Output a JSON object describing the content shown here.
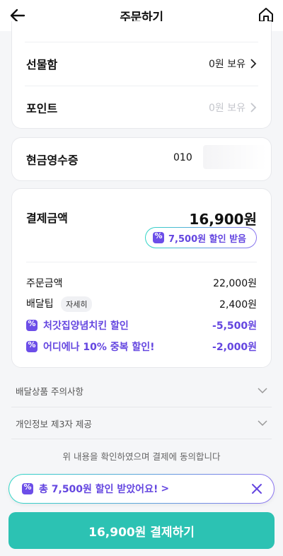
{
  "header": {
    "title": "주문하기",
    "back_icon": "arrow-left-icon",
    "home_icon": "home-icon"
  },
  "gift_box": {
    "label": "선물함",
    "value": "0원 보유"
  },
  "points": {
    "label": "포인트",
    "value": "0원 보유"
  },
  "cash_receipt": {
    "label": "현금영수증",
    "value": "010"
  },
  "payment": {
    "label": "결제금액",
    "total": "16,900원",
    "discount_badge": "7,500원 할인 받음",
    "lines": [
      {
        "label": "주문금액",
        "value": "22,000원"
      },
      {
        "label": "배달팁",
        "tag": "자세히",
        "value": "2,400원"
      }
    ],
    "discounts": [
      {
        "label": "처갓집양념치킨 할인",
        "value": "-5,500원"
      },
      {
        "label": "어디에나 10% 중복 할인!",
        "value": "-2,000원"
      }
    ]
  },
  "notices": [
    {
      "label": "배달상품 주의사항"
    },
    {
      "label": "개인정보 제3자 제공"
    }
  ],
  "agreement": "위 내용을 확인하였으며 결제에 동의합니다",
  "promo_bar": {
    "text": "총 7,500원 할인 받았어요!",
    "arrow": ">"
  },
  "pay_button": {
    "label": "16,900원 결제하기"
  },
  "colors": {
    "accent": "#2cc2b3",
    "discount_purple": "#6446e0"
  }
}
